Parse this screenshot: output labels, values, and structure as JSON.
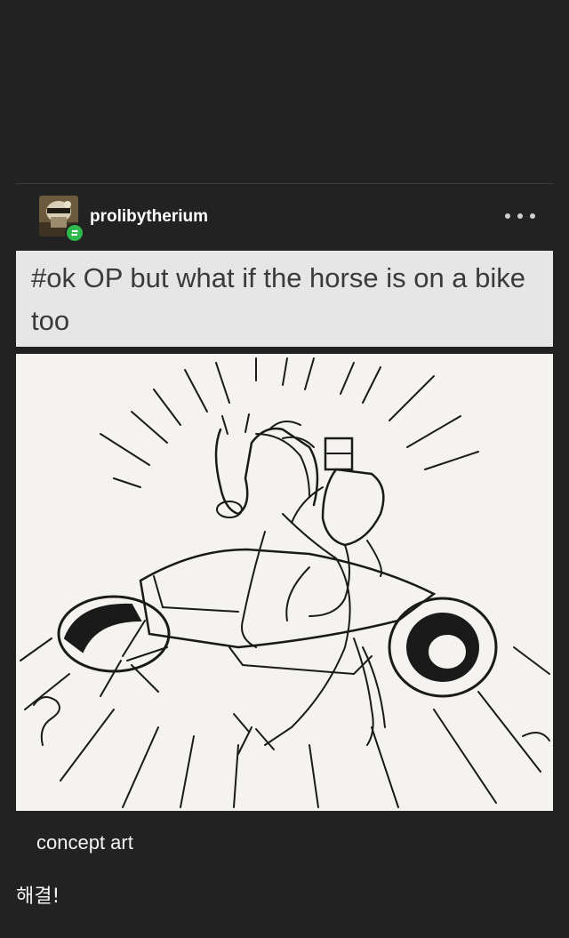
{
  "post": {
    "username": "prolibytherium",
    "avatar_icon": "knight-helmet-avatar",
    "badge_icon": "reblog-icon",
    "menu_icon": "more-dots-icon",
    "tags_text": "#ok OP but what if the horse is on a bike too",
    "image_description_icon": "horse-riding-motorcycle-illustration",
    "caption": "concept art"
  },
  "comment": {
    "text": "해결!"
  },
  "colors": {
    "background": "#222222",
    "tag_block": "#e6e6e6",
    "badge": "#2fb84e",
    "art_paper": "#f4f3ef"
  }
}
